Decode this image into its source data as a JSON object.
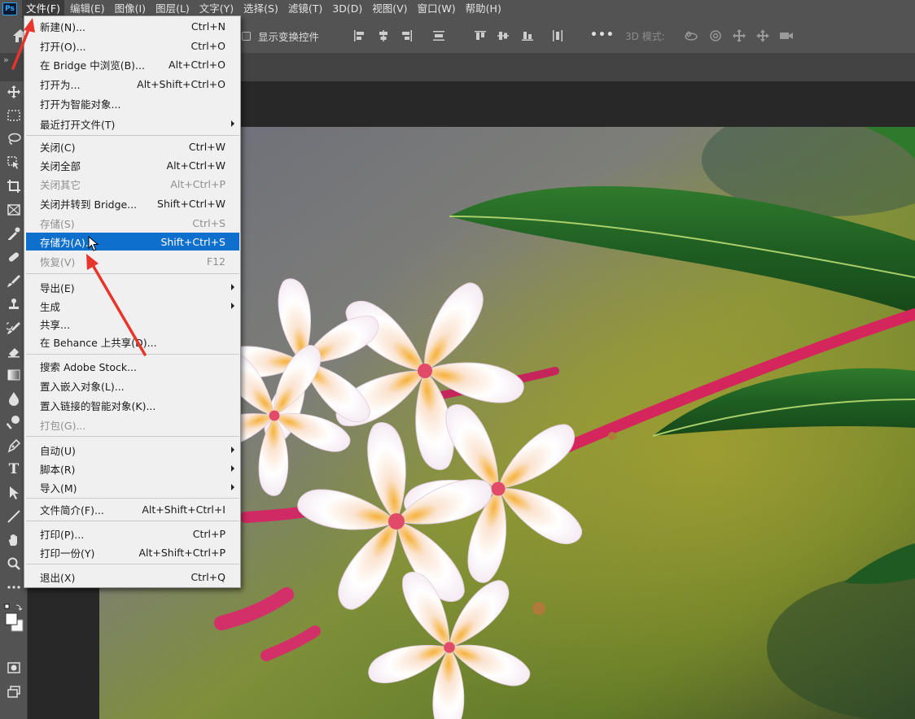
{
  "app": {
    "logo_text": "Ps"
  },
  "menubar": {
    "items": [
      "文件(F)",
      "编辑(E)",
      "图像(I)",
      "图层(L)",
      "文字(Y)",
      "选择(S)",
      "滤镜(T)",
      "3D(D)",
      "视图(V)",
      "窗口(W)",
      "帮助(H)"
    ],
    "active_index": 0
  },
  "options": {
    "show_transform_label": "显示变换控件",
    "mode_label": "3D 模式:",
    "more_label": "•••"
  },
  "tabstrip": {
    "collapse_label": "»"
  },
  "tools": {
    "type_tool_label": "T"
  },
  "file_menu": {
    "items": [
      {
        "label": "新建(N)...",
        "shortcut": "Ctrl+N"
      },
      {
        "label": "打开(O)...",
        "shortcut": "Ctrl+O"
      },
      {
        "label": "在 Bridge 中浏览(B)...",
        "shortcut": "Alt+Ctrl+O"
      },
      {
        "label": "打开为...",
        "shortcut": "Alt+Shift+Ctrl+O"
      },
      {
        "label": "打开为智能对象...",
        "shortcut": ""
      },
      {
        "label": "最近打开文件(T)",
        "shortcut": ""
      },
      {
        "label": "关闭(C)",
        "shortcut": "Ctrl+W"
      },
      {
        "label": "关闭全部",
        "shortcut": "Alt+Ctrl+W"
      },
      {
        "label": "关闭其它",
        "shortcut": "Alt+Ctrl+P"
      },
      {
        "label": "关闭并转到 Bridge...",
        "shortcut": "Shift+Ctrl+W"
      },
      {
        "label": "存储(S)",
        "shortcut": "Ctrl+S"
      },
      {
        "label": "存储为(A)...",
        "shortcut": "Shift+Ctrl+S"
      },
      {
        "label": "恢复(V)",
        "shortcut": "F12"
      },
      {
        "label": "导出(E)",
        "shortcut": ""
      },
      {
        "label": "生成",
        "shortcut": ""
      },
      {
        "label": "共享...",
        "shortcut": ""
      },
      {
        "label": "在 Behance 上共享(D)...",
        "shortcut": ""
      },
      {
        "label": "搜索 Adobe Stock...",
        "shortcut": ""
      },
      {
        "label": "置入嵌入对象(L)...",
        "shortcut": ""
      },
      {
        "label": "置入链接的智能对象(K)...",
        "shortcut": ""
      },
      {
        "label": "打包(G)...",
        "shortcut": ""
      },
      {
        "label": "自动(U)",
        "shortcut": ""
      },
      {
        "label": "脚本(R)",
        "shortcut": ""
      },
      {
        "label": "导入(M)",
        "shortcut": ""
      },
      {
        "label": "文件简介(F)...",
        "shortcut": "Alt+Shift+Ctrl+I"
      },
      {
        "label": "打印(P)...",
        "shortcut": "Ctrl+P"
      },
      {
        "label": "打印一份(Y)",
        "shortcut": "Alt+Shift+Ctrl+P"
      },
      {
        "label": "退出(X)",
        "shortcut": "Ctrl+Q"
      }
    ],
    "highlighted_label": "存储为(A)..."
  },
  "colors": {
    "menubar": "#535353",
    "menu_bg": "#f0f0f0",
    "highlight": "#0f6fcd",
    "annotation_arrow": "#e8352b"
  }
}
